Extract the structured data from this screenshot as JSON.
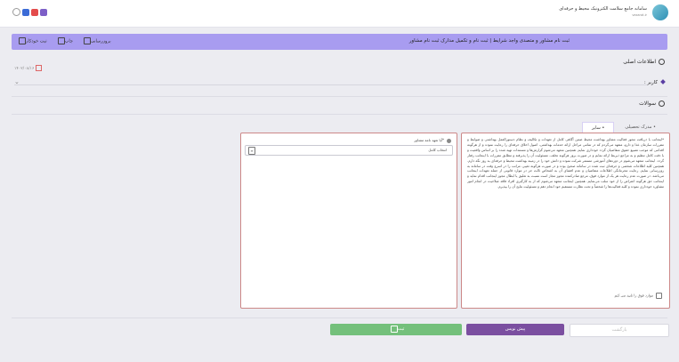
{
  "header": {
    "title": "سامانه جامع سلامت الکترونیک محیط و حرفه‌ای",
    "subtitle": "vezarat.ir"
  },
  "title_bar": {
    "title": "ثبت نام مشاور و متصدی واجد شرایط | ثبت نام و تکمیل مدارک ثبت نام مشاور",
    "tool_refresh": "بروزرسانی",
    "tool_print": "چاپ",
    "tool_help": "ثبت خودکار"
  },
  "basic_info": {
    "heading": "اطلاعات اصلی",
    "date": "۱۴۰۲/۰۸/۱۶",
    "career_label": "کاربر :"
  },
  "questions": {
    "heading": "سوالات",
    "tabs": [
      {
        "label": "• سایر",
        "active": true
      },
      {
        "label": "• مدرک تحصیلی",
        "active": false
      }
    ],
    "text": "*اینجانب با دریافت مجوز فعالیت مشاور بهداشت محیط ضمن آگاهی کامل از تعهدات و تکالیف و نظام دستورالعمل بهداشتی و ضوابط و مقررات سازمان غذا و دارو، متعهد می‌گردم که در تمامی مراحل ارائه خدمات بهداشتی، اصول اخلاق حرفه‌ای را رعایت نموده و از هرگونه اقدامی که موجب تضییع حقوق متقاضیان گردد خودداری نمایم. همچنین متعهد می‌شوم گزارش‌ها و مستندات تهیه شده را بر اساس واقعیت و با دقت کامل تنظیم و به مراجع ذیربط ارائه نمایم و در صورت بروز هرگونه تخلف، مسئولیت آن را پذیرفته و مطابق مقررات با اینجانب رفتار گردد. اینجانب متعهد می‌شوم در دوره‌های آموزشی مستمر شرکت نموده و دانش خود را در زمینه بهداشت محیط و حرفه‌ای به روز نگه دارم. همچنین کلیه اطلاعات شخصی و حرفه‌ای ثبت شده در سامانه صحیح بوده و در صورت هرگونه تغییر، مراتب را در اسرع وقت در سامانه به روزرسانی نمایم. رعایت محرمانگی اطلاعات متقاضیان و عدم افشای آن به اشخاص ثالث جز در موارد قانونی از جمله تعهدات اینجانب می‌باشد. در صورت عدم رعایت هر یک از موارد فوق، مرجع صادرکننده مجوز مجاز است نسبت به تعلیق یا ابطال مجوز اینجانب اقدام نماید و اینجانب حق هرگونه اعتراض را از خود سلب می‌نمایم. همچنین اینجانب متعهد می‌شوم که از به کارگیری افراد فاقد صلاحیت در انجام امور مشاوره خودداری نموده و کلیه فعالیت‌ها را شخصاً و تحت نظارت مستقیم خود انجام دهم و مسئولیت نتایج آن را بپذیرم.",
    "ack_label": "موارد فوق را تایید می کنم",
    "commitment_label": "*آیا تعهد نامه مشاور",
    "commitment_value": "انتخاب کامل"
  },
  "footer": {
    "next_label": "بازگشت",
    "draft_label": "پیش نویس",
    "submit_label": "ثبت"
  }
}
